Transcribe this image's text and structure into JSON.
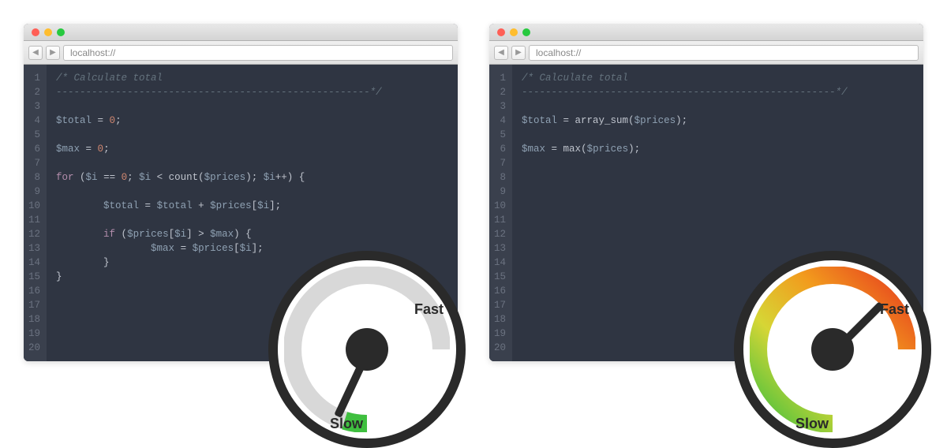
{
  "left": {
    "url": "localhost://",
    "gauge": {
      "fast": "Fast",
      "slow": "Slow",
      "needle_deg": 115,
      "state": "slow"
    },
    "code": [
      {
        "indent": 0,
        "tokens": [
          {
            "c": "c-comment",
            "t": "/* Calculate total"
          }
        ]
      },
      {
        "indent": 0,
        "tokens": [
          {
            "c": "c-comment",
            "t": "-----------------------------------------------------*/"
          }
        ]
      },
      {
        "indent": 0,
        "tokens": []
      },
      {
        "indent": 0,
        "tokens": [
          {
            "c": "c-var",
            "t": "$total"
          },
          {
            "c": "c-op",
            "t": " = "
          },
          {
            "c": "c-num",
            "t": "0"
          },
          {
            "c": "c-punc",
            "t": ";"
          }
        ]
      },
      {
        "indent": 0,
        "tokens": []
      },
      {
        "indent": 0,
        "tokens": [
          {
            "c": "c-var",
            "t": "$max"
          },
          {
            "c": "c-op",
            "t": " = "
          },
          {
            "c": "c-num",
            "t": "0"
          },
          {
            "c": "c-punc",
            "t": ";"
          }
        ]
      },
      {
        "indent": 0,
        "tokens": []
      },
      {
        "indent": 0,
        "tokens": [
          {
            "c": "c-kw",
            "t": "for"
          },
          {
            "c": "c-punc",
            "t": " ("
          },
          {
            "c": "c-var",
            "t": "$i"
          },
          {
            "c": "c-op",
            "t": " == "
          },
          {
            "c": "c-num",
            "t": "0"
          },
          {
            "c": "c-punc",
            "t": "; "
          },
          {
            "c": "c-var",
            "t": "$i"
          },
          {
            "c": "c-op",
            "t": " < "
          },
          {
            "c": "c-fn",
            "t": "count"
          },
          {
            "c": "c-punc",
            "t": "("
          },
          {
            "c": "c-var",
            "t": "$prices"
          },
          {
            "c": "c-punc",
            "t": "); "
          },
          {
            "c": "c-var",
            "t": "$i"
          },
          {
            "c": "c-op",
            "t": "++"
          },
          {
            "c": "c-punc",
            "t": ") {"
          }
        ]
      },
      {
        "indent": 0,
        "tokens": []
      },
      {
        "indent": 2,
        "tokens": [
          {
            "c": "c-var",
            "t": "$total"
          },
          {
            "c": "c-op",
            "t": " = "
          },
          {
            "c": "c-var",
            "t": "$total"
          },
          {
            "c": "c-op",
            "t": " + "
          },
          {
            "c": "c-var",
            "t": "$prices"
          },
          {
            "c": "c-punc",
            "t": "["
          },
          {
            "c": "c-var",
            "t": "$i"
          },
          {
            "c": "c-punc",
            "t": "];"
          }
        ]
      },
      {
        "indent": 0,
        "tokens": []
      },
      {
        "indent": 2,
        "tokens": [
          {
            "c": "c-kw",
            "t": "if"
          },
          {
            "c": "c-punc",
            "t": " ("
          },
          {
            "c": "c-var",
            "t": "$prices"
          },
          {
            "c": "c-punc",
            "t": "["
          },
          {
            "c": "c-var",
            "t": "$i"
          },
          {
            "c": "c-punc",
            "t": "] "
          },
          {
            "c": "c-op",
            "t": ">"
          },
          {
            "c": "c-punc",
            "t": " "
          },
          {
            "c": "c-var",
            "t": "$max"
          },
          {
            "c": "c-punc",
            "t": ") {"
          }
        ]
      },
      {
        "indent": 4,
        "tokens": [
          {
            "c": "c-var",
            "t": "$max"
          },
          {
            "c": "c-op",
            "t": " = "
          },
          {
            "c": "c-var",
            "t": "$prices"
          },
          {
            "c": "c-punc",
            "t": "["
          },
          {
            "c": "c-var",
            "t": "$i"
          },
          {
            "c": "c-punc",
            "t": "];"
          }
        ]
      },
      {
        "indent": 2,
        "tokens": [
          {
            "c": "c-punc",
            "t": "}"
          }
        ]
      },
      {
        "indent": 0,
        "tokens": [
          {
            "c": "c-punc",
            "t": "}"
          }
        ]
      },
      {
        "indent": 0,
        "tokens": []
      },
      {
        "indent": 0,
        "tokens": []
      },
      {
        "indent": 0,
        "tokens": []
      },
      {
        "indent": 0,
        "tokens": []
      },
      {
        "indent": 0,
        "tokens": []
      }
    ]
  },
  "right": {
    "url": "localhost://",
    "gauge": {
      "fast": "Fast",
      "slow": "Slow",
      "needle_deg": -45,
      "state": "fast"
    },
    "code": [
      {
        "indent": 0,
        "tokens": [
          {
            "c": "c-comment",
            "t": "/* Calculate total"
          }
        ]
      },
      {
        "indent": 0,
        "tokens": [
          {
            "c": "c-comment",
            "t": "-----------------------------------------------------*/"
          }
        ]
      },
      {
        "indent": 0,
        "tokens": []
      },
      {
        "indent": 0,
        "tokens": [
          {
            "c": "c-var",
            "t": "$total"
          },
          {
            "c": "c-op",
            "t": " = "
          },
          {
            "c": "c-fn",
            "t": "array_sum"
          },
          {
            "c": "c-punc",
            "t": "("
          },
          {
            "c": "c-var",
            "t": "$prices"
          },
          {
            "c": "c-punc",
            "t": ");"
          }
        ]
      },
      {
        "indent": 0,
        "tokens": []
      },
      {
        "indent": 0,
        "tokens": [
          {
            "c": "c-var",
            "t": "$max"
          },
          {
            "c": "c-op",
            "t": " = "
          },
          {
            "c": "c-fn",
            "t": "max"
          },
          {
            "c": "c-punc",
            "t": "("
          },
          {
            "c": "c-var",
            "t": "$prices"
          },
          {
            "c": "c-punc",
            "t": ");"
          }
        ]
      },
      {
        "indent": 0,
        "tokens": []
      },
      {
        "indent": 0,
        "tokens": []
      },
      {
        "indent": 0,
        "tokens": []
      },
      {
        "indent": 0,
        "tokens": []
      },
      {
        "indent": 0,
        "tokens": []
      },
      {
        "indent": 0,
        "tokens": []
      },
      {
        "indent": 0,
        "tokens": []
      },
      {
        "indent": 0,
        "tokens": []
      },
      {
        "indent": 0,
        "tokens": []
      },
      {
        "indent": 0,
        "tokens": []
      },
      {
        "indent": 0,
        "tokens": []
      },
      {
        "indent": 0,
        "tokens": []
      },
      {
        "indent": 0,
        "tokens": []
      },
      {
        "indent": 0,
        "tokens": []
      }
    ]
  }
}
